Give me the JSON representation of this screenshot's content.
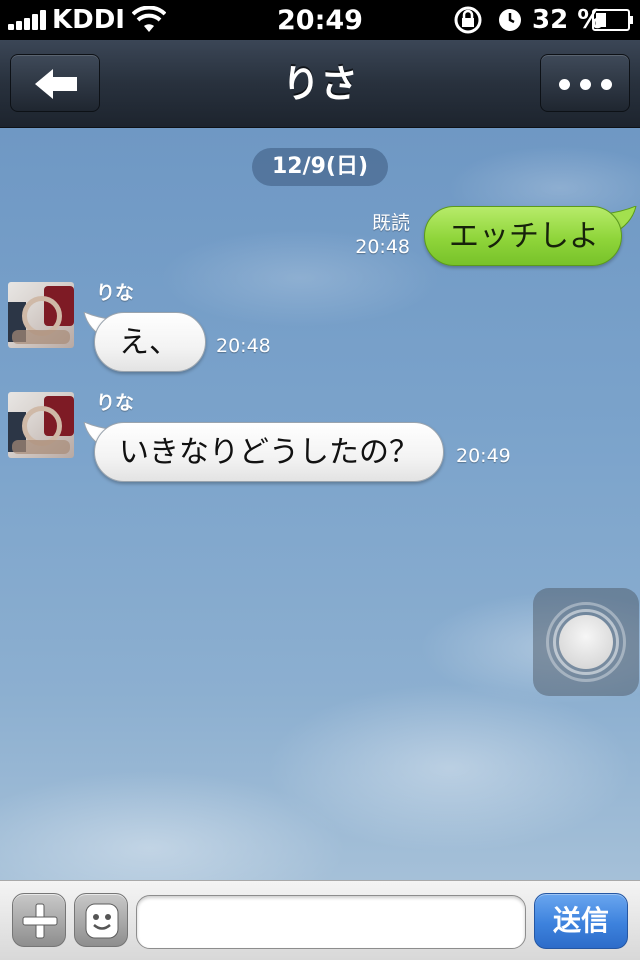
{
  "status_bar": {
    "carrier": "KDDI",
    "time": "20:49",
    "battery_percent": "32 %",
    "battery_level": 0.32,
    "icons": [
      "signal-icon",
      "wifi-icon",
      "rotation-lock-icon",
      "alarm-icon",
      "battery-icon"
    ]
  },
  "nav": {
    "title": "りさ",
    "back_icon": "back-arrow-icon",
    "more_icon": "more-dots-icon"
  },
  "chat": {
    "date": "12/9(日)",
    "messages": [
      {
        "direction": "outgoing",
        "text": "エッチしよ",
        "read_label": "既読",
        "time": "20:48"
      },
      {
        "direction": "incoming",
        "sender": "りな",
        "text": "え、",
        "time": "20:48"
      },
      {
        "direction": "incoming",
        "sender": "りな",
        "text": "いきなりどうしたの？",
        "time": "20:49"
      }
    ]
  },
  "input_bar": {
    "plus_icon": "plus-icon",
    "sticker_icon": "smiley-icon",
    "message_value": "",
    "send_label": "送信"
  },
  "colors": {
    "outgoing_bubble": "#8fd53a",
    "incoming_bubble": "#ffffff",
    "send_button": "#3d82dd",
    "nav_bar": "#28313d"
  }
}
